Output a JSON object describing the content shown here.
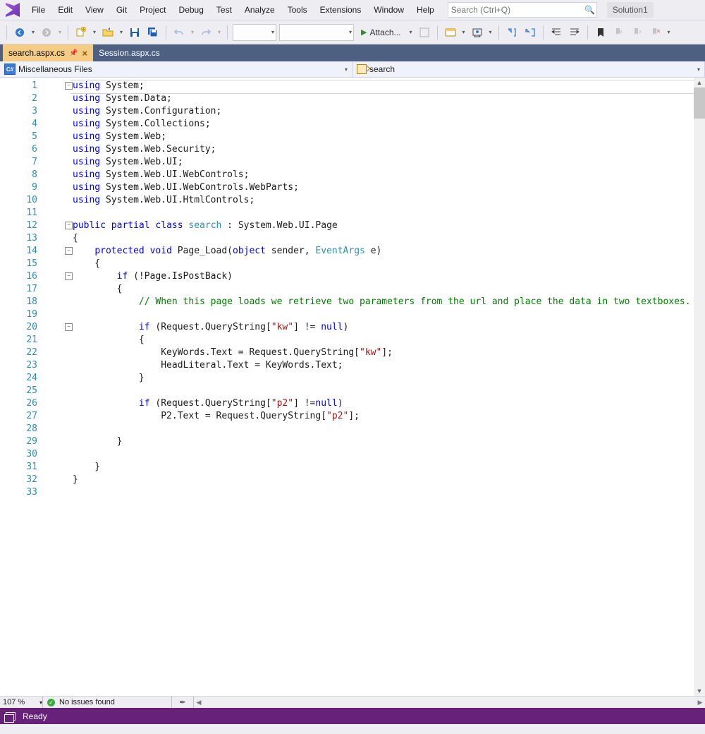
{
  "menubar": {
    "items": [
      "File",
      "Edit",
      "View",
      "Git",
      "Project",
      "Debug",
      "Test",
      "Analyze",
      "Tools",
      "Extensions",
      "Window",
      "Help"
    ],
    "searchPlaceholder": "Search (Ctrl+Q)",
    "solution": "Solution1"
  },
  "toolbar": {
    "attach": "Attach..."
  },
  "tabs": {
    "active": "search.aspx.cs",
    "inactive": "Session.aspx.cs"
  },
  "navbar": {
    "left": "Miscellaneous Files",
    "right": "search"
  },
  "footer": {
    "zoom": "107 %",
    "issues": "No issues found"
  },
  "status": {
    "text": "Ready"
  },
  "code": {
    "lines": [
      [
        [
          "kw",
          "using"
        ],
        [
          "",
          " System;"
        ]
      ],
      [
        [
          "kw",
          "using"
        ],
        [
          "",
          " System.Data;"
        ]
      ],
      [
        [
          "kw",
          "using"
        ],
        [
          "",
          " System.Configuration;"
        ]
      ],
      [
        [
          "kw",
          "using"
        ],
        [
          "",
          " System.Collections;"
        ]
      ],
      [
        [
          "kw",
          "using"
        ],
        [
          "",
          " System.Web;"
        ]
      ],
      [
        [
          "kw",
          "using"
        ],
        [
          "",
          " System.Web.Security;"
        ]
      ],
      [
        [
          "kw",
          "using"
        ],
        [
          "",
          " System.Web.UI;"
        ]
      ],
      [
        [
          "kw",
          "using"
        ],
        [
          "",
          " System.Web.UI.WebControls;"
        ]
      ],
      [
        [
          "kw",
          "using"
        ],
        [
          "",
          " System.Web.UI.WebControls.WebParts;"
        ]
      ],
      [
        [
          "kw",
          "using"
        ],
        [
          "",
          " System.Web.UI.HtmlControls;"
        ]
      ],
      [
        [
          "",
          ""
        ]
      ],
      [
        [
          "kw",
          "public"
        ],
        [
          "",
          " "
        ],
        [
          "kw",
          "partial"
        ],
        [
          "",
          " "
        ],
        [
          "kw",
          "class"
        ],
        [
          "",
          " "
        ],
        [
          "typ",
          "search"
        ],
        [
          "",
          " : System.Web.UI.Page"
        ]
      ],
      [
        [
          "",
          "{"
        ]
      ],
      [
        [
          "",
          "    "
        ],
        [
          "kw",
          "protected"
        ],
        [
          "",
          " "
        ],
        [
          "kw",
          "void"
        ],
        [
          "",
          " Page_Load("
        ],
        [
          "kw",
          "object"
        ],
        [
          "",
          " sender, "
        ],
        [
          "typ",
          "EventArgs"
        ],
        [
          "",
          " e)"
        ]
      ],
      [
        [
          "",
          "    {"
        ]
      ],
      [
        [
          "",
          "        "
        ],
        [
          "kw",
          "if"
        ],
        [
          "",
          " (!Page.IsPostBack)"
        ]
      ],
      [
        [
          "",
          "        {"
        ]
      ],
      [
        [
          "",
          "            "
        ],
        [
          "cmt",
          "// When this page loads we retrieve two parameters from the url and place the data in two textboxes."
        ]
      ],
      [
        [
          "",
          ""
        ]
      ],
      [
        [
          "",
          "            "
        ],
        [
          "kw",
          "if"
        ],
        [
          "",
          " (Request.QueryString["
        ],
        [
          "str",
          "\"kw\""
        ],
        [
          "",
          "] != "
        ],
        [
          "kw",
          "null"
        ],
        [
          "",
          ")"
        ]
      ],
      [
        [
          "",
          "            {"
        ]
      ],
      [
        [
          "",
          "                KeyWords.Text = Request.QueryString["
        ],
        [
          "str",
          "\"kw\""
        ],
        [
          "",
          "];"
        ]
      ],
      [
        [
          "",
          "                HeadLiteral.Text = KeyWords.Text;"
        ]
      ],
      [
        [
          "",
          "            }"
        ]
      ],
      [
        [
          "",
          ""
        ]
      ],
      [
        [
          "",
          "            "
        ],
        [
          "kw",
          "if"
        ],
        [
          "",
          " (Request.QueryString["
        ],
        [
          "str",
          "\"p2\""
        ],
        [
          "",
          "] !="
        ],
        [
          "kw",
          "null"
        ],
        [
          "",
          ")"
        ]
      ],
      [
        [
          "",
          "                P2.Text = Request.QueryString["
        ],
        [
          "str",
          "\"p2\""
        ],
        [
          "",
          "];"
        ]
      ],
      [
        [
          "",
          ""
        ]
      ],
      [
        [
          "",
          "        }"
        ]
      ],
      [
        [
          "",
          ""
        ]
      ],
      [
        [
          "",
          "    }"
        ]
      ],
      [
        [
          "",
          "}"
        ]
      ],
      [
        [
          "",
          ""
        ]
      ]
    ]
  }
}
